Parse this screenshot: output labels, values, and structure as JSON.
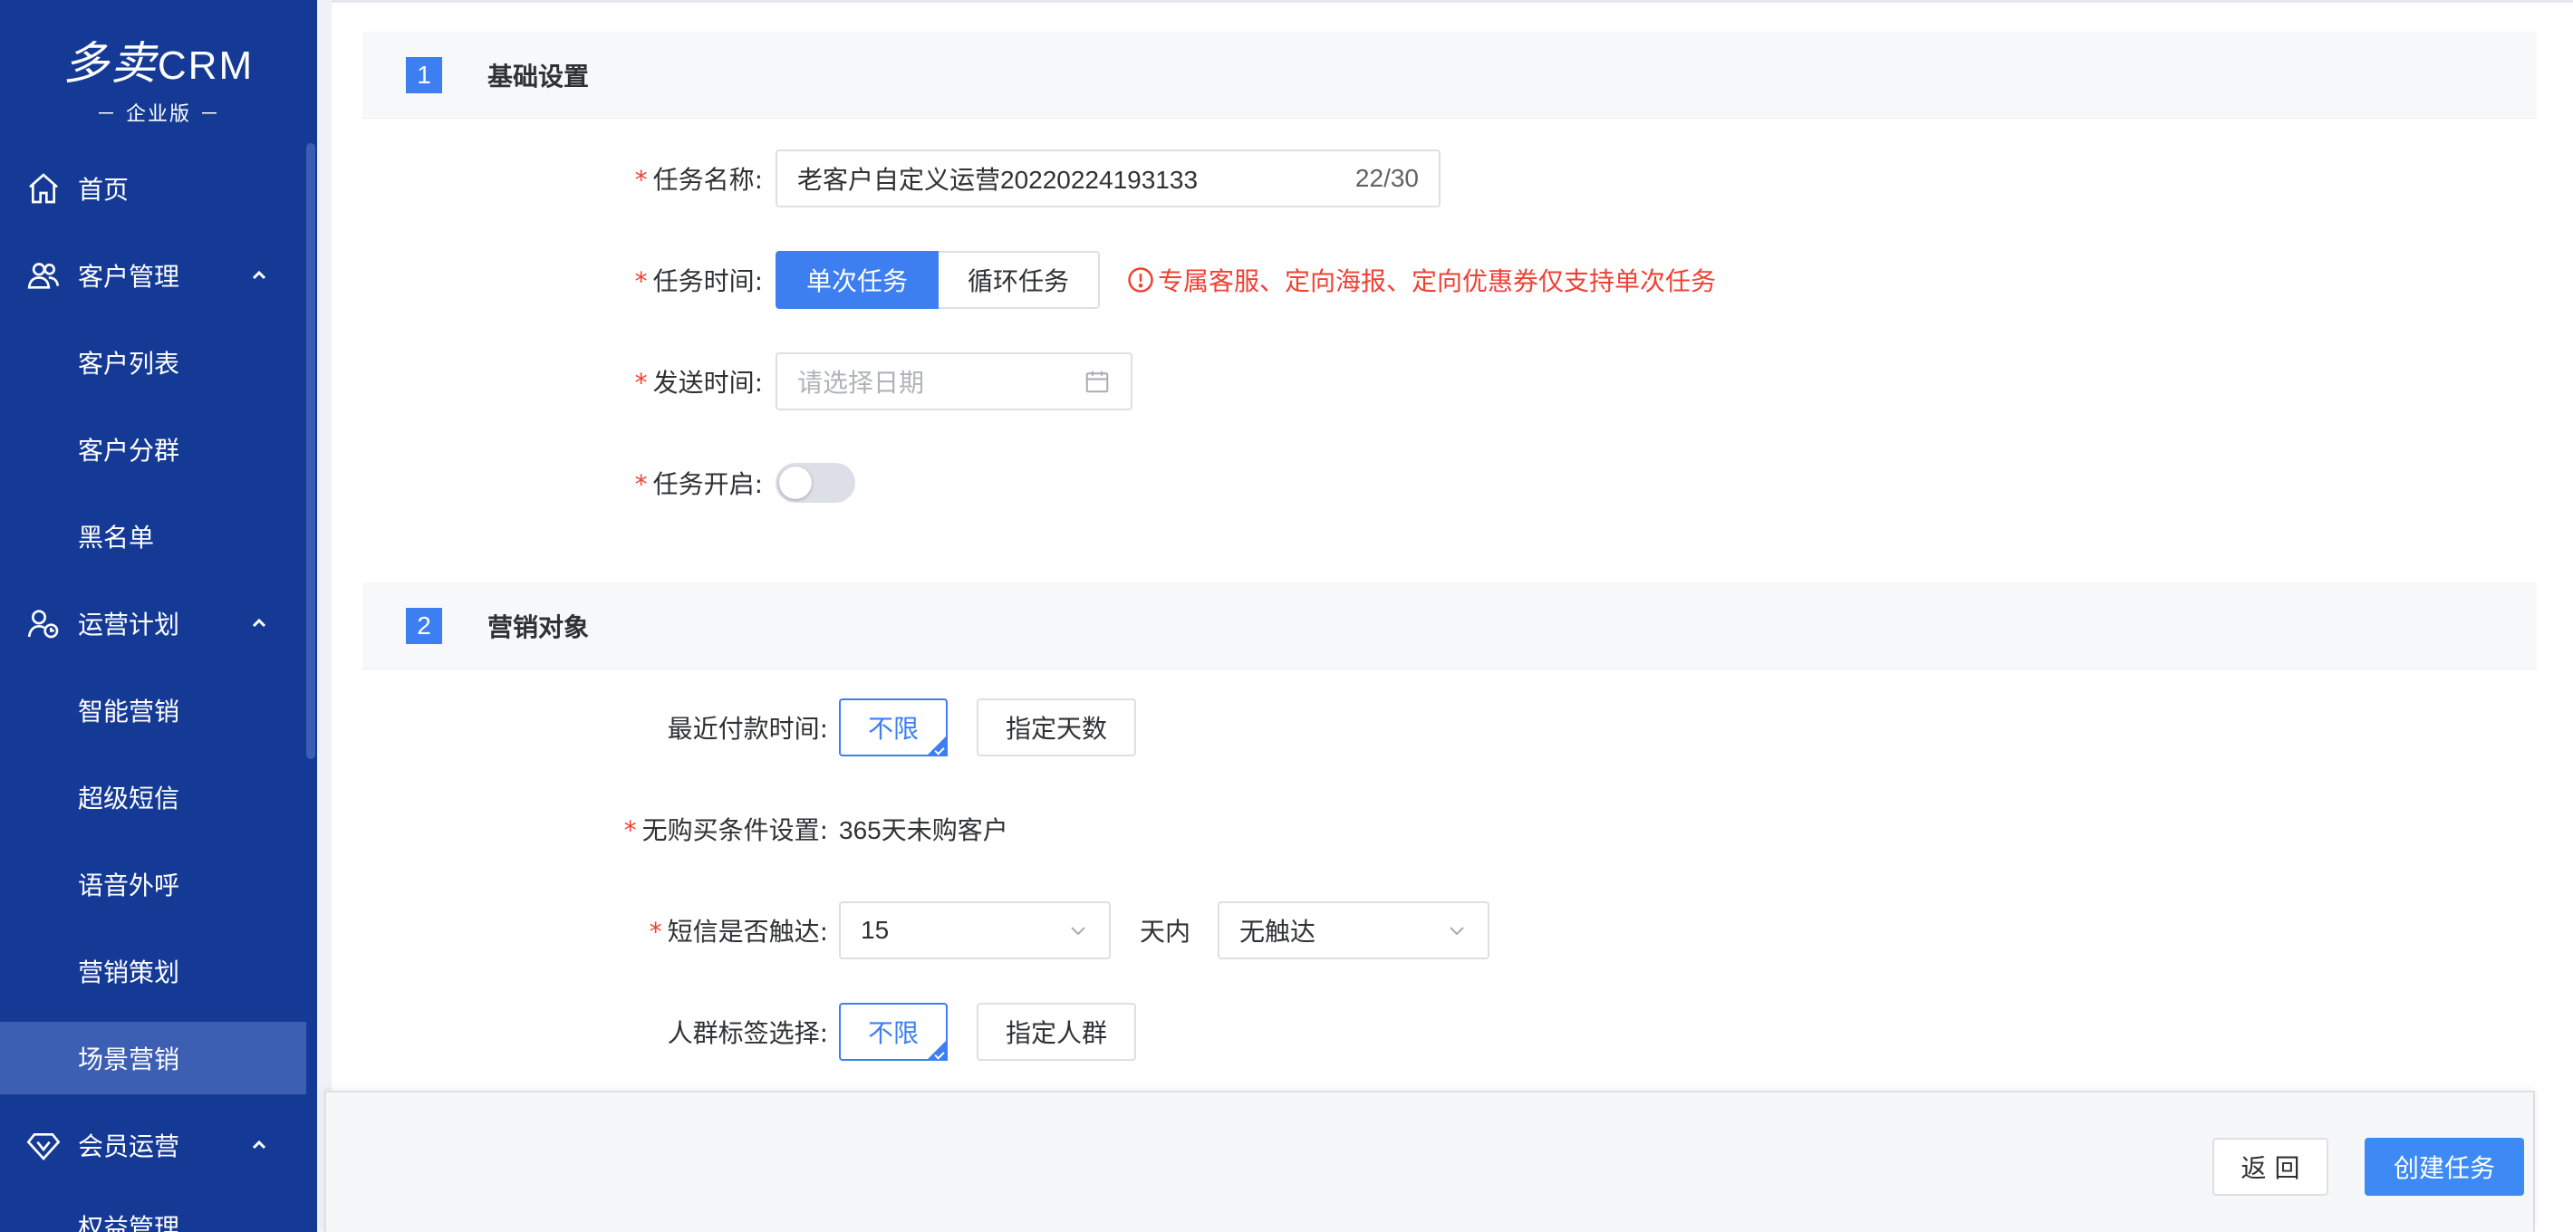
{
  "sidebar": {
    "logo_title": "多卖",
    "logo_title_suffix": "CRM",
    "logo_sub": "－  企业版  －",
    "items": [
      {
        "label": "首页",
        "icon": "home-icon"
      },
      {
        "label": "客户管理",
        "icon": "users-icon"
      },
      {
        "label": "客户列表"
      },
      {
        "label": "客户分群"
      },
      {
        "label": "黑名单"
      },
      {
        "label": "运营计划",
        "icon": "plan-icon"
      },
      {
        "label": "智能营销"
      },
      {
        "label": "超级短信"
      },
      {
        "label": "语音外呼"
      },
      {
        "label": "营销策划"
      },
      {
        "label": "场景营销",
        "active": true
      },
      {
        "label": "会员运营",
        "icon": "diamond-icon"
      },
      {
        "label": "权益管理"
      }
    ]
  },
  "section1": {
    "num": "1",
    "title": "基础设置",
    "task_name_label": "任务名称:",
    "task_name_value": "老客户自定义运营20220224193133",
    "task_name_count": "22/30",
    "task_time_label": "任务时间:",
    "seg_once": "单次任务",
    "seg_loop": "循环任务",
    "warning": "专属客服、定向海报、定向优惠券仅支持单次任务",
    "send_time_label": "发送时间:",
    "send_time_placeholder": "请选择日期",
    "task_enable_label": "任务开启:",
    "task_enabled": false
  },
  "section2": {
    "num": "2",
    "title": "营销对象",
    "recent_pay_label": "最近付款时间:",
    "chip_unlimited": "不限",
    "chip_days": "指定天数",
    "no_buy_label": "无购买条件设置:",
    "no_buy_value": "365天未购客户",
    "sms_label": "短信是否触达:",
    "sms_days": "15",
    "sms_within": "天内",
    "sms_reach": "无触达",
    "crowd_label": "人群标签选择:",
    "chip_crowd_unlimited": "不限",
    "chip_crowd": "指定人群"
  },
  "footer": {
    "back": "返 回",
    "create": "创建任务"
  },
  "colors": {
    "sidebar": "#153a96",
    "primary": "#3d7ff0",
    "danger": "#f04134"
  }
}
